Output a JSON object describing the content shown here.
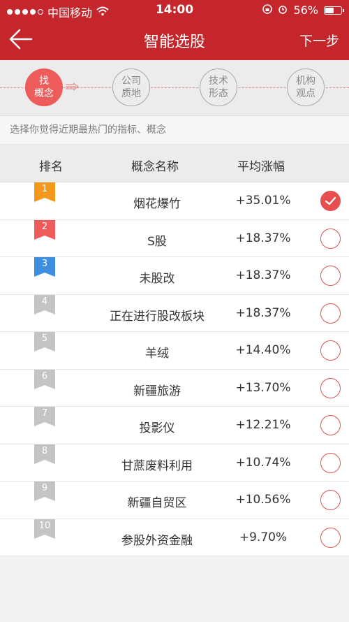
{
  "status_bar": {
    "carrier": "中国移动",
    "time": "14:00",
    "battery": "56%",
    "battery_level": 0.56
  },
  "nav": {
    "title": "智能选股",
    "next_label": "下一步"
  },
  "steps": [
    {
      "line1": "找",
      "line2": "概念",
      "active": true
    },
    {
      "line1": "公司",
      "line2": "质地",
      "active": false
    },
    {
      "line1": "技术",
      "line2": "形态",
      "active": false
    },
    {
      "line1": "机构",
      "line2": "观点",
      "active": false
    }
  ],
  "hint": "选择你觉得近期最热门的指标、概念",
  "table": {
    "headers": {
      "rank": "排名",
      "name": "概念名称",
      "change": "平均涨幅"
    },
    "rows": [
      {
        "rank": "1",
        "name": "烟花爆竹",
        "change": "+35.01%",
        "selected": true,
        "flag_color": "#f39a1c"
      },
      {
        "rank": "2",
        "name": "S股",
        "change": "+18.37%",
        "selected": false,
        "flag_color": "#ef5b5b"
      },
      {
        "rank": "3",
        "name": "未股改",
        "change": "+18.37%",
        "selected": false,
        "flag_color": "#3f8fe0"
      },
      {
        "rank": "4",
        "name": "正在进行股改板块",
        "change": "+18.37%",
        "selected": false,
        "flag_color": "#c4c4c4"
      },
      {
        "rank": "5",
        "name": "羊绒",
        "change": "+14.40%",
        "selected": false,
        "flag_color": "#c4c4c4"
      },
      {
        "rank": "6",
        "name": "新疆旅游",
        "change": "+13.70%",
        "selected": false,
        "flag_color": "#c4c4c4"
      },
      {
        "rank": "7",
        "name": "投影仪",
        "change": "+12.21%",
        "selected": false,
        "flag_color": "#c4c4c4"
      },
      {
        "rank": "8",
        "name": "甘蔗废料利用",
        "change": "+10.74%",
        "selected": false,
        "flag_color": "#c4c4c4"
      },
      {
        "rank": "9",
        "name": "新疆自贸区",
        "change": "+10.56%",
        "selected": false,
        "flag_color": "#c4c4c4"
      },
      {
        "rank": "10",
        "name": "参股外资金融",
        "change": "+9.70%",
        "selected": false,
        "flag_color": "#c4c4c4"
      }
    ]
  }
}
